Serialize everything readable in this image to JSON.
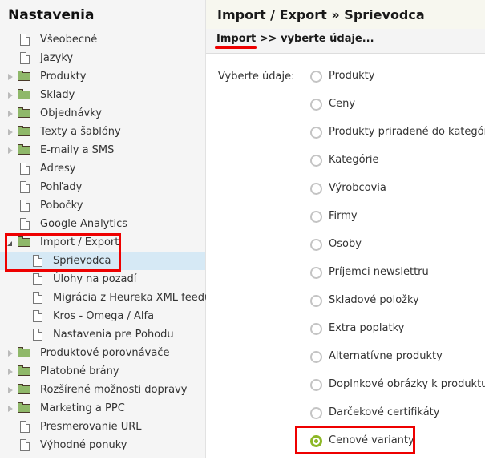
{
  "sidebar": {
    "title": "Nastavenia",
    "items": [
      {
        "label": "Všeobecné",
        "type": "page",
        "level": 0
      },
      {
        "label": "Jazyky",
        "type": "page",
        "level": 0
      },
      {
        "label": "Produkty",
        "type": "folder",
        "level": 0,
        "expanded": false
      },
      {
        "label": "Sklady",
        "type": "folder",
        "level": 0,
        "expanded": false
      },
      {
        "label": "Objednávky",
        "type": "folder",
        "level": 0,
        "expanded": false
      },
      {
        "label": "Texty a šablóny",
        "type": "folder",
        "level": 0,
        "expanded": false
      },
      {
        "label": "E-maily a SMS",
        "type": "folder",
        "level": 0,
        "expanded": false
      },
      {
        "label": "Adresy",
        "type": "page",
        "level": 0
      },
      {
        "label": "Pohľady",
        "type": "page",
        "level": 0
      },
      {
        "label": "Pobočky",
        "type": "page",
        "level": 0
      },
      {
        "label": "Google Analytics",
        "type": "page",
        "level": 0
      },
      {
        "label": "Import / Export",
        "type": "folder",
        "level": 0,
        "expanded": true
      },
      {
        "label": "Sprievodca",
        "type": "page",
        "level": 1,
        "selected": true
      },
      {
        "label": "Úlohy na pozadí",
        "type": "page",
        "level": 1
      },
      {
        "label": "Migrácia z Heureka XML feedu",
        "type": "page",
        "level": 1
      },
      {
        "label": "Kros - Omega / Alfa",
        "type": "page",
        "level": 1
      },
      {
        "label": "Nastavenia pre Pohodu",
        "type": "page",
        "level": 1
      },
      {
        "label": "Produktové porovnávače",
        "type": "folder",
        "level": 0,
        "expanded": false
      },
      {
        "label": "Platobné brány",
        "type": "folder",
        "level": 0,
        "expanded": false
      },
      {
        "label": "Rozšírené možnosti dopravy",
        "type": "folder",
        "level": 0,
        "expanded": false
      },
      {
        "label": "Marketing a PPC",
        "type": "folder",
        "level": 0,
        "expanded": false
      },
      {
        "label": "Presmerovanie URL",
        "type": "page",
        "level": 0
      },
      {
        "label": "Výhodné ponuky",
        "type": "page",
        "level": 0
      }
    ]
  },
  "main": {
    "title": "Import / Export » Sprievodca",
    "breadcrumb": {
      "step": "Import",
      "separator": " >> ",
      "current": "vyberte údaje..."
    },
    "field_label": "Vyberte údaje:",
    "options": [
      {
        "label": "Produkty",
        "checked": false
      },
      {
        "label": "Ceny",
        "checked": false
      },
      {
        "label": "Produkty priradené do kategórií",
        "checked": false
      },
      {
        "label": "Kategórie",
        "checked": false
      },
      {
        "label": "Výrobcovia",
        "checked": false
      },
      {
        "label": "Firmy",
        "checked": false
      },
      {
        "label": "Osoby",
        "checked": false
      },
      {
        "label": "Príjemci newslettru",
        "checked": false
      },
      {
        "label": "Skladové položky",
        "checked": false
      },
      {
        "label": "Extra poplatky",
        "checked": false
      },
      {
        "label": "Alternatívne produkty",
        "checked": false
      },
      {
        "label": "Doplnkové obrázky k produktu",
        "checked": false
      },
      {
        "label": "Darčekové certifikáty",
        "checked": false
      },
      {
        "label": "Cenové varianty",
        "checked": true
      }
    ]
  },
  "colors": {
    "highlight": "#e00000",
    "radio_checked": "#8db827",
    "selected_row": "#d6e9f5",
    "folder": "#8fb86a"
  }
}
